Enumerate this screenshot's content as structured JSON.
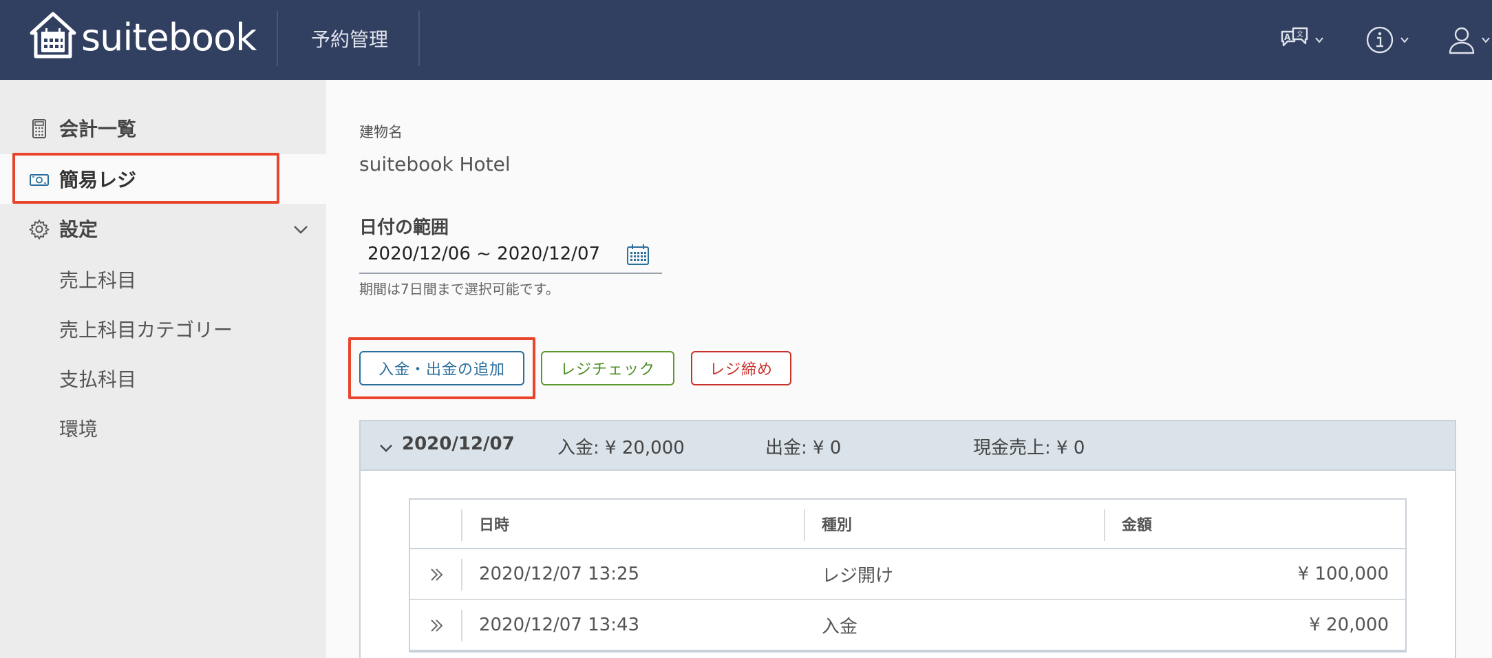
{
  "header": {
    "logo_text": "suitebook",
    "title": "予約管理",
    "icons": [
      "translate-icon",
      "info-icon",
      "user-icon"
    ]
  },
  "sidebar": {
    "items": [
      {
        "label": "会計一覧",
        "icon": "calculator-icon"
      },
      {
        "label": "簡易レジ",
        "icon": "cash-icon",
        "active": true
      },
      {
        "label": "設定",
        "icon": "gear-icon"
      }
    ],
    "sub_items": [
      "売上科目",
      "売上科目カテゴリー",
      "支払科目",
      "環境"
    ]
  },
  "main": {
    "building_label": "建物名",
    "building_value": "suitebook Hotel",
    "date_range_label": "日付の範囲",
    "date_range_value": "2020/12/06 ~ 2020/12/07",
    "date_hint": "期間は7日間まで選択可能です。",
    "buttons": {
      "add": "入金・出金の追加",
      "check": "レジチェック",
      "close": "レジ締め"
    },
    "group": {
      "date": "2020/12/07",
      "deposit": "入金: ¥ 20,000",
      "withdrawal": "出金: ¥ 0",
      "cash_sales": "現金売上: ¥ 0"
    },
    "table": {
      "columns": [
        "日時",
        "種別",
        "金額"
      ],
      "rows": [
        {
          "datetime": "2020/12/07 13:25",
          "type": "レジ開け",
          "amount": "¥ 100,000"
        },
        {
          "datetime": "2020/12/07 13:43",
          "type": "入金",
          "amount": "¥ 20,000"
        }
      ]
    }
  },
  "colors": {
    "header_bg": "#313f61",
    "sidebar_bg": "#ececec",
    "highlight": "#e8452c",
    "btn_blue": "#2a6e9c",
    "btn_green": "#4b8d22",
    "btn_red": "#c8312a"
  }
}
